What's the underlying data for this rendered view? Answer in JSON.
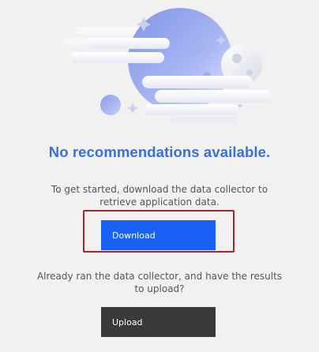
{
  "empty_state": {
    "title": "No recommendations available.",
    "download_prompt": "To get started, download the data collector to retrieve application data.",
    "download_button": "Download",
    "upload_prompt": "Already ran the data collector, and have the results to upload?",
    "upload_button": "Upload"
  },
  "colors": {
    "accent": "#1a62f5",
    "title": "#3a6fe0",
    "highlight": "#a0282e",
    "upload_button": "#3a3a3a"
  }
}
